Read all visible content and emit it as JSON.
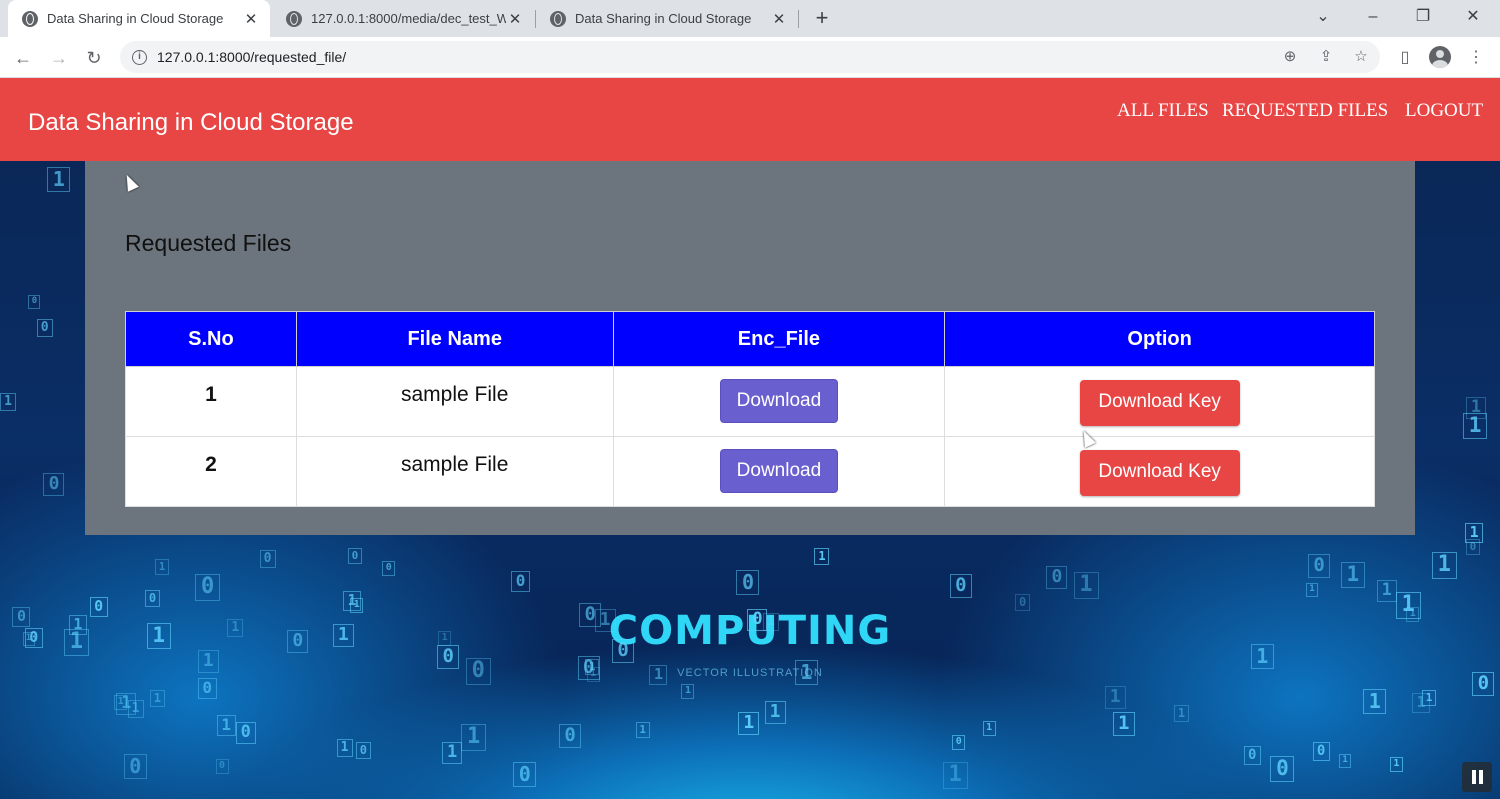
{
  "browser": {
    "tabs": [
      {
        "title": "Data Sharing in Cloud Storage",
        "active": true
      },
      {
        "title": "127.0.0.1:8000/media/dec_test_W",
        "active": false
      },
      {
        "title": "Data Sharing in Cloud Storage",
        "active": false
      }
    ],
    "url": "127.0.0.1:8000/requested_file/"
  },
  "navbar": {
    "brand": "Data Sharing in Cloud Storage",
    "links": [
      "ALL FILES",
      "REQUESTED FILES",
      "LOGOUT"
    ],
    "color": "#e84545"
  },
  "main": {
    "heading": "Requested Files",
    "table": {
      "headers": [
        "S.No",
        "File Name",
        "Enc_File",
        "Option"
      ],
      "rows": [
        {
          "sno": "1",
          "file_name": "sample File",
          "enc_button": "Download",
          "option_button": "Download Key"
        },
        {
          "sno": "2",
          "file_name": "sample File",
          "enc_button": "Download",
          "option_button": "Download Key"
        }
      ]
    }
  },
  "background": {
    "headline": "COMPUTING",
    "subline": "VECTOR ILLUSTRATION"
  }
}
